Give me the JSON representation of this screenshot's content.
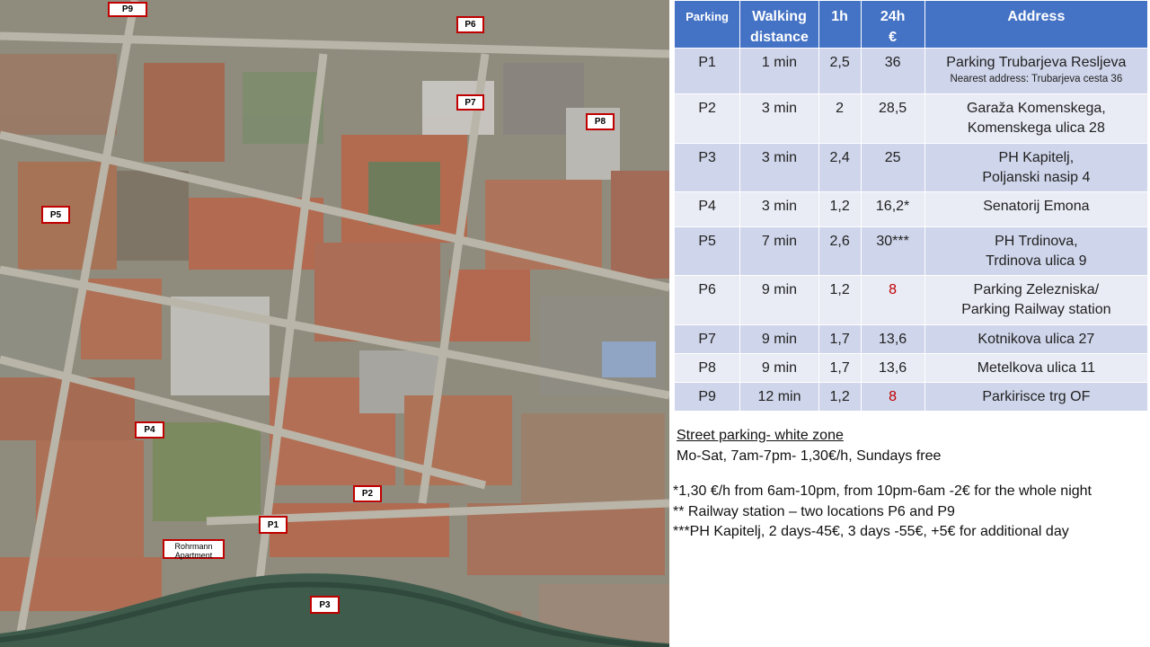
{
  "map": {
    "markers": [
      {
        "id": "p9",
        "label": "P9"
      },
      {
        "id": "p6",
        "label": "P6"
      },
      {
        "id": "p7",
        "label": "P7"
      },
      {
        "id": "p8",
        "label": "P8"
      },
      {
        "id": "p5",
        "label": "P5"
      },
      {
        "id": "p4",
        "label": "P4"
      },
      {
        "id": "p2",
        "label": "P2"
      },
      {
        "id": "p1",
        "label": "P1"
      },
      {
        "id": "p3",
        "label": "P3"
      }
    ],
    "apartment": {
      "line1": "Rohrmann",
      "line2": "Apartment"
    }
  },
  "table": {
    "headers": {
      "parking": "Parking",
      "walking_1": "Walking",
      "walking_2": "distance",
      "h1": "1h",
      "h24_1": "24h",
      "h24_2": "€",
      "address": "Address"
    },
    "rows": [
      {
        "parking": "P1",
        "walk": "1 min",
        "h1": "2,5",
        "h24": "36",
        "addr1": "Parking Trubarjeva Resljeva",
        "addr2": "",
        "sub": "Nearest address: Trubarjeva cesta 36"
      },
      {
        "parking": "P2",
        "walk": "3 min",
        "h1": "2",
        "h24": "28,5",
        "addr1": "Garaža Komenskega,",
        "addr2": "Komenskega ulica 28",
        "sub": ""
      },
      {
        "parking": "P3",
        "walk": "3 min",
        "h1": "2,4",
        "h24": "25",
        "addr1": "PH Kapitelj,",
        "addr2": "Poljanski nasip 4",
        "sub": ""
      },
      {
        "parking": "P4",
        "walk": "3 min",
        "h1": "1,2",
        "h24": "16,2*",
        "addr1": "Senatorij Emona",
        "addr2": "",
        "sub": ""
      },
      {
        "parking": "P5",
        "walk": "7 min",
        "h1": "2,6",
        "h24": "30***",
        "addr1": "PH Trdinova,",
        "addr2": "Trdinova ulica 9",
        "sub": ""
      },
      {
        "parking": "P6",
        "walk": "9 min",
        "h1": "1,2",
        "h24": "8",
        "addr1": "Parking Zelezniska/",
        "addr2": "Parking Railway station",
        "sub": ""
      },
      {
        "parking": "P7",
        "walk": "9 min",
        "h1": "1,7",
        "h24": "13,6",
        "addr1": "Kotnikova ulica 27",
        "addr2": "",
        "sub": ""
      },
      {
        "parking": "P8",
        "walk": "9 min",
        "h1": "1,7",
        "h24": "13,6",
        "addr1": "Metelkova ulica 11",
        "addr2": "",
        "sub": ""
      },
      {
        "parking": "P9",
        "walk": "12 min",
        "h1": "1,2",
        "h24": "8",
        "addr1": "Parkirisce trg OF",
        "addr2": "",
        "sub": ""
      }
    ],
    "highlight_color": "#c00000",
    "header_color": "#4472c4"
  },
  "notes": {
    "street_title": "Street parking- white zone",
    "street_text": "Mo-Sat, 7am-7pm- 1,30€/h, Sundays free",
    "fn1": "*1,30 €/h from 6am-10pm, from 10pm-6am -2€ for the whole night",
    "fn2": "** Railway station – two locations P6 and P9",
    "fn3": "***PH Kapitelj, 2 days-45€, 3 days -55€, +5€ for additional day"
  }
}
